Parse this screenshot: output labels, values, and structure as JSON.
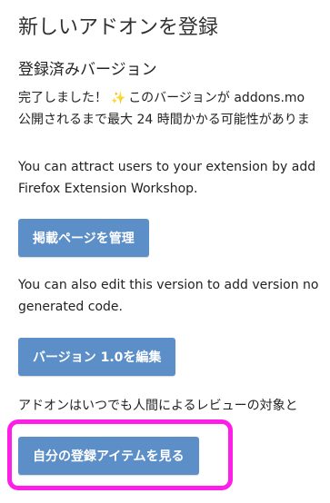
{
  "page": {
    "title": "新しいアドオンを登録",
    "section_title": "登録済みバージョン"
  },
  "success": {
    "line1_pre": "完了しました！",
    "sparkle": "✨",
    "line1_post": "このバージョンが addons.mo",
    "line2": "公開されるまで最大 24 時間かかる可能性がありま"
  },
  "attract": {
    "line1": "You can attract users to your extension by add",
    "line2": "Firefox Extension Workshop."
  },
  "buttons": {
    "manage_listing": "掲載ページを管理",
    "edit_version": "バージョン 1.0を編集",
    "view_submissions": "自分の登録アイテムを見る"
  },
  "edit_note": {
    "line1": "You can also edit this version to add version no",
    "line2": "generated code."
  },
  "review_note": {
    "line1": "アドオンはいつでも人間によるレビューの対象と"
  },
  "colors": {
    "button_bg": "#5c8ec8",
    "highlight_border": "#ff1ee8"
  },
  "icons": {
    "sparkle": "sparkle-icon"
  }
}
